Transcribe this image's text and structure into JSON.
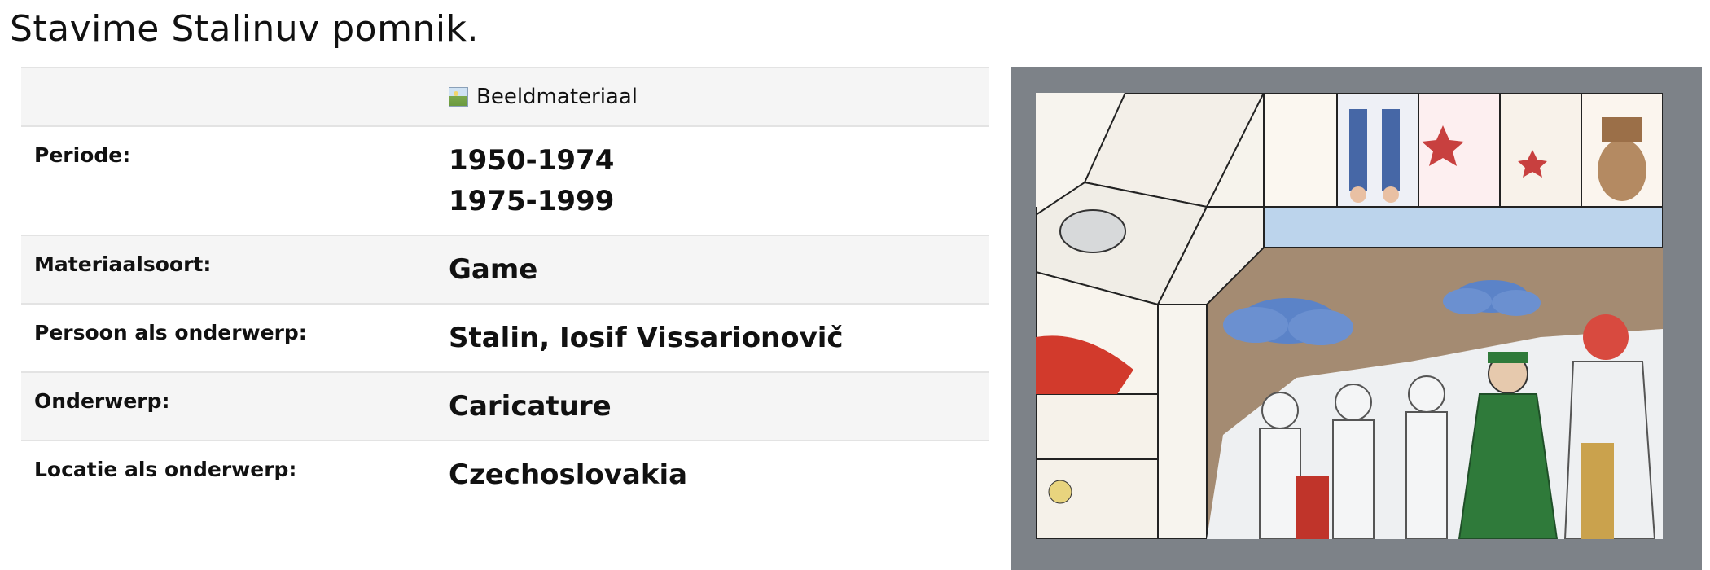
{
  "page": {
    "title": "Stavime Stalinuv pomnik."
  },
  "details": {
    "media_label": "Beeldmateriaal",
    "rows": [
      {
        "label": "Periode:",
        "values": [
          "1950-1974",
          "1975-1999"
        ]
      },
      {
        "label": "Materiaalsoort:",
        "values": [
          "Game"
        ]
      },
      {
        "label": "Persoon als onderwerp:",
        "values": [
          "Stalin, Iosif Vissarionovič"
        ]
      },
      {
        "label": "Onderwerp:",
        "values": [
          "Caricature"
        ]
      },
      {
        "label": "Locatie als onderwerp:",
        "values": [
          "Czechoslovakia"
        ]
      }
    ]
  },
  "image": {
    "icon": "board-game-image"
  }
}
